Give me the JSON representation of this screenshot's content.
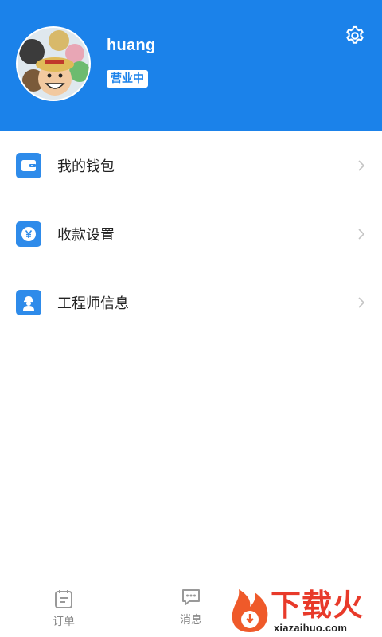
{
  "profile": {
    "username": "huang",
    "status_badge": "营业中",
    "avatar_icon": "avatar-image",
    "settings_icon": "gear-icon"
  },
  "menu": {
    "items": [
      {
        "label": "我的钱包",
        "icon": "wallet-icon"
      },
      {
        "label": "收款设置",
        "icon": "yen-coin-icon"
      },
      {
        "label": "工程师信息",
        "icon": "engineer-icon"
      }
    ]
  },
  "tabbar": {
    "tabs": [
      {
        "label": "订单",
        "icon": "order-list-icon"
      },
      {
        "label": "消息",
        "icon": "chat-bubble-icon"
      }
    ]
  },
  "watermark": {
    "text": "下载火",
    "url": "xiazaihuo.com"
  },
  "colors": {
    "header_blue": "#1b82ea",
    "icon_blue": "#2e8bea",
    "text_dark": "#222222",
    "text_gray": "#888888",
    "watermark_red": "#e83a2a"
  }
}
